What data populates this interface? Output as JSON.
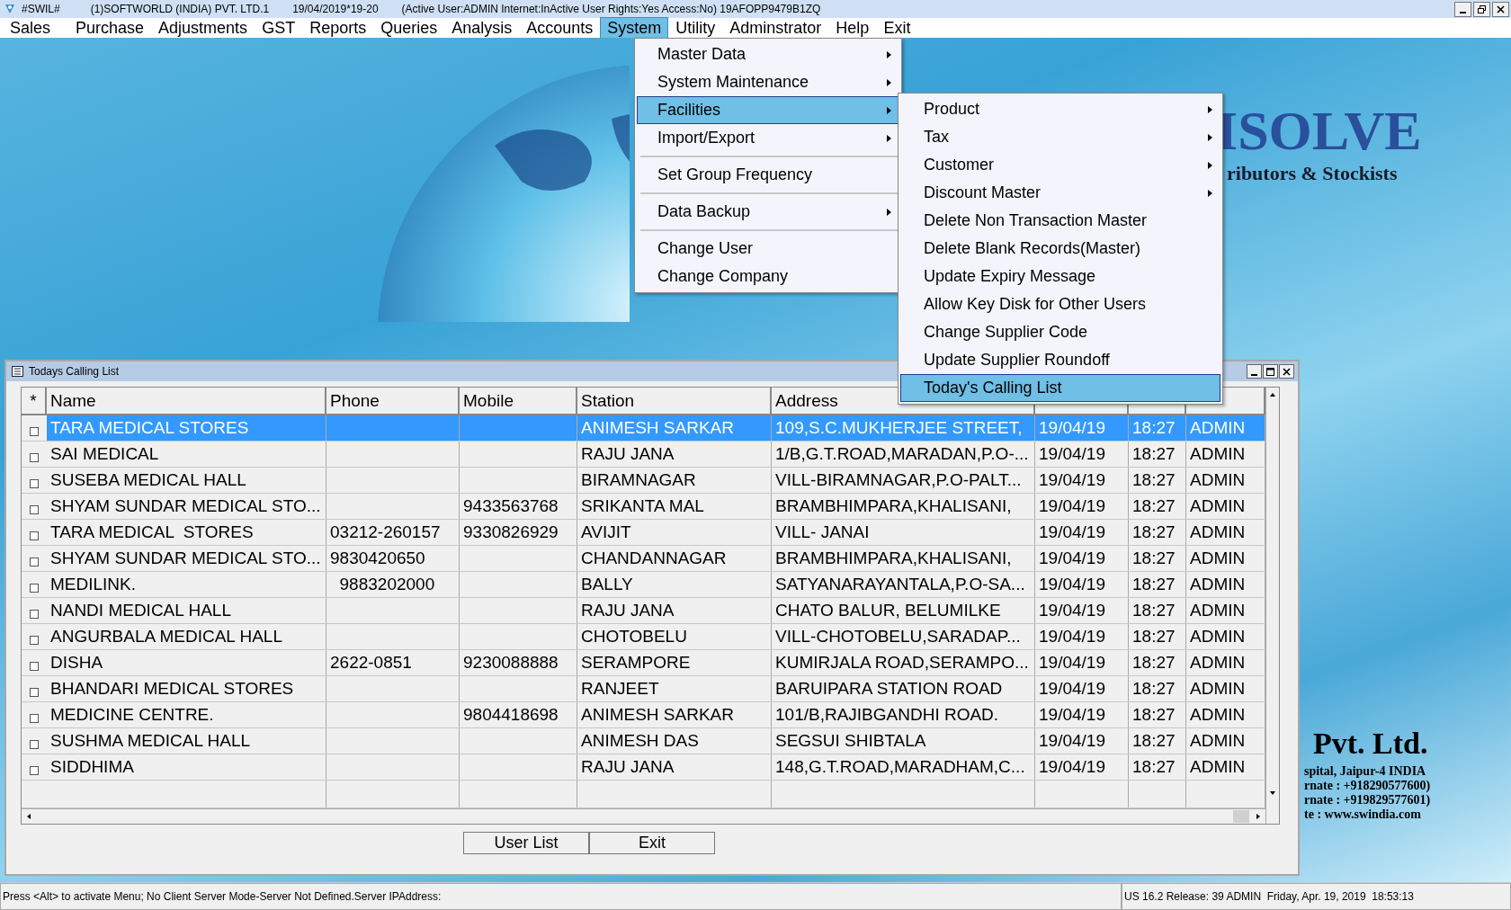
{
  "window": {
    "title_parts": [
      "#SWIL#",
      "(1)SOFTWORLD (INDIA) PVT. LTD.1",
      "19/04/2019*19-20",
      "(Active User:ADMIN Internet:InActive User Rights:Yes Access:No) 19AFOPP9479B1ZQ"
    ]
  },
  "menubar": [
    {
      "label": "Sales",
      "selected": false
    },
    {
      "label": "Purchase",
      "selected": false
    },
    {
      "label": "Adjustments",
      "selected": false
    },
    {
      "label": "GST",
      "selected": false
    },
    {
      "label": "Reports",
      "selected": false
    },
    {
      "label": "Queries",
      "selected": false
    },
    {
      "label": "Analysis",
      "selected": false
    },
    {
      "label": "Accounts",
      "selected": false
    },
    {
      "label": "System",
      "selected": true
    },
    {
      "label": "Utility",
      "selected": false
    },
    {
      "label": "Adminstrator",
      "selected": false
    },
    {
      "label": "Help",
      "selected": false
    },
    {
      "label": "Exit",
      "selected": false
    }
  ],
  "system_menu": [
    {
      "kind": "item",
      "label": "Master Data",
      "has_submenu": true,
      "selected": false
    },
    {
      "kind": "item",
      "label": "System Maintenance",
      "has_submenu": true,
      "selected": false
    },
    {
      "kind": "item",
      "label": "Facilities",
      "has_submenu": true,
      "selected": true
    },
    {
      "kind": "item",
      "label": "Import/Export",
      "has_submenu": true,
      "selected": false
    },
    {
      "kind": "separator"
    },
    {
      "kind": "item",
      "label": "Set Group Frequency",
      "has_submenu": false,
      "selected": false
    },
    {
      "kind": "separator"
    },
    {
      "kind": "item",
      "label": "Data Backup",
      "has_submenu": true,
      "selected": false
    },
    {
      "kind": "separator"
    },
    {
      "kind": "item",
      "label": "Change User",
      "has_submenu": false,
      "selected": false
    },
    {
      "kind": "item",
      "label": "Change Company",
      "has_submenu": false,
      "selected": false
    }
  ],
  "facilities_menu": [
    {
      "label": "Product",
      "has_submenu": true,
      "selected": false
    },
    {
      "label": "Tax",
      "has_submenu": true,
      "selected": false
    },
    {
      "label": "Customer",
      "has_submenu": true,
      "selected": false
    },
    {
      "label": "Discount Master",
      "has_submenu": true,
      "selected": false
    },
    {
      "label": "Delete Non Transaction Master",
      "has_submenu": false,
      "selected": false
    },
    {
      "label": "Delete Blank Records(Master)",
      "has_submenu": false,
      "selected": false
    },
    {
      "label": "Update Expiry Message",
      "has_submenu": false,
      "selected": false
    },
    {
      "label": "Allow Key Disk for Other Users",
      "has_submenu": false,
      "selected": false
    },
    {
      "label": "Change Supplier Code",
      "has_submenu": false,
      "selected": false
    },
    {
      "label": "Update Supplier Roundoff",
      "has_submenu": false,
      "selected": false
    },
    {
      "label": "Today's Calling List",
      "has_submenu": false,
      "selected": true
    }
  ],
  "background": {
    "logo": "ISOLVE",
    "tagline": "ributors & Stockists",
    "company": "Pvt. Ltd.",
    "address_lines": [
      "spital, Jaipur-4 INDIA",
      "rnate : +918290577600)",
      "rnate : +919829577601)",
      "te : www.swindia.com"
    ]
  },
  "child_window": {
    "title": "Todays Calling List",
    "table": {
      "checkbox_header": "*",
      "columns": [
        "Name",
        "Phone",
        "Mobile",
        "Station",
        "Address"
      ],
      "rows": [
        {
          "selected": true,
          "checked": false,
          "cells": [
            "TARA MEDICAL STORES",
            "",
            "",
            "ANIMESH SARKAR",
            "109,S.C.MUKHERJEE STREET,",
            "19/04/19",
            "18:27",
            "ADMIN"
          ]
        },
        {
          "selected": false,
          "checked": false,
          "cells": [
            "SAI MEDICAL",
            "",
            "",
            "RAJU JANA",
            "1/B,G.T.ROAD,MARADAN,P.O-...",
            "19/04/19",
            "18:27",
            "ADMIN"
          ]
        },
        {
          "selected": false,
          "checked": false,
          "cells": [
            "SUSEBA MEDICAL HALL",
            "",
            "",
            "BIRAMNAGAR",
            "VILL-BIRAMNAGAR,P.O-PALT...",
            "19/04/19",
            "18:27",
            "ADMIN"
          ]
        },
        {
          "selected": false,
          "checked": false,
          "cells": [
            "SHYAM SUNDAR MEDICAL STO...",
            "",
            "9433563768",
            "SRIKANTA MAL",
            "BRAMBHIMPARA,KHALISANI,",
            "19/04/19",
            "18:27",
            "ADMIN"
          ]
        },
        {
          "selected": false,
          "checked": false,
          "cells": [
            "TARA MEDICAL  STORES",
            "03212-260157",
            "9330826929",
            "AVIJIT",
            "VILL- JANAI",
            "19/04/19",
            "18:27",
            "ADMIN"
          ]
        },
        {
          "selected": false,
          "checked": false,
          "cells": [
            "SHYAM SUNDAR MEDICAL STO...",
            "9830420650",
            "",
            "CHANDANNAGAR",
            "BRAMBHIMPARA,KHALISANI,",
            "19/04/19",
            "18:27",
            "ADMIN"
          ]
        },
        {
          "selected": false,
          "checked": false,
          "cells": [
            "MEDILINK.",
            "  9883202000",
            "",
            "BALLY",
            "SATYANARAYANTALA,P.O-SA...",
            "19/04/19",
            "18:27",
            "ADMIN"
          ]
        },
        {
          "selected": false,
          "checked": false,
          "cells": [
            "NANDI MEDICAL HALL",
            "",
            "",
            "RAJU JANA",
            "CHATO BALUR, BELUMILKE",
            "19/04/19",
            "18:27",
            "ADMIN"
          ]
        },
        {
          "selected": false,
          "checked": false,
          "cells": [
            "ANGURBALA MEDICAL HALL",
            "",
            "",
            "CHOTOBELU",
            "VILL-CHOTOBELU,SARADAP...",
            "19/04/19",
            "18:27",
            "ADMIN"
          ]
        },
        {
          "selected": false,
          "checked": false,
          "cells": [
            "DISHA",
            "2622-0851",
            "9230088888",
            "SERAMPORE",
            "KUMIRJALA ROAD,SERAMPO...",
            "19/04/19",
            "18:27",
            "ADMIN"
          ]
        },
        {
          "selected": false,
          "checked": false,
          "cells": [
            "BHANDARI MEDICAL STORES",
            "",
            "",
            "RANJEET",
            "BARUIPARA STATION ROAD",
            "19/04/19",
            "18:27",
            "ADMIN"
          ]
        },
        {
          "selected": false,
          "checked": false,
          "cells": [
            "MEDICINE CENTRE.",
            "",
            "9804418698",
            "ANIMESH SARKAR",
            "101/B,RAJIBGANDHI ROAD.",
            "19/04/19",
            "18:27",
            "ADMIN"
          ]
        },
        {
          "selected": false,
          "checked": false,
          "cells": [
            "SUSHMA MEDICAL HALL",
            "",
            "",
            "ANIMESH DAS",
            "SEGSUI SHIBTALA",
            "19/04/19",
            "18:27",
            "ADMIN"
          ]
        },
        {
          "selected": false,
          "checked": false,
          "cells": [
            "SIDDHIMA",
            "",
            "",
            "RAJU JANA",
            "148,G.T.ROAD,MARADHAM,C...",
            "19/04/19",
            "18:27",
            "ADMIN"
          ]
        }
      ]
    },
    "buttons": [
      "User List",
      "Exit"
    ]
  },
  "status_bar": {
    "left": "Press <Alt> to activate Menu; No Client Server Mode-Server Not Defined.Server IPAddress:",
    "right": "US 16.2 Release: 39 ADMIN  Friday, Apr. 19, 2019  18:53:13"
  }
}
